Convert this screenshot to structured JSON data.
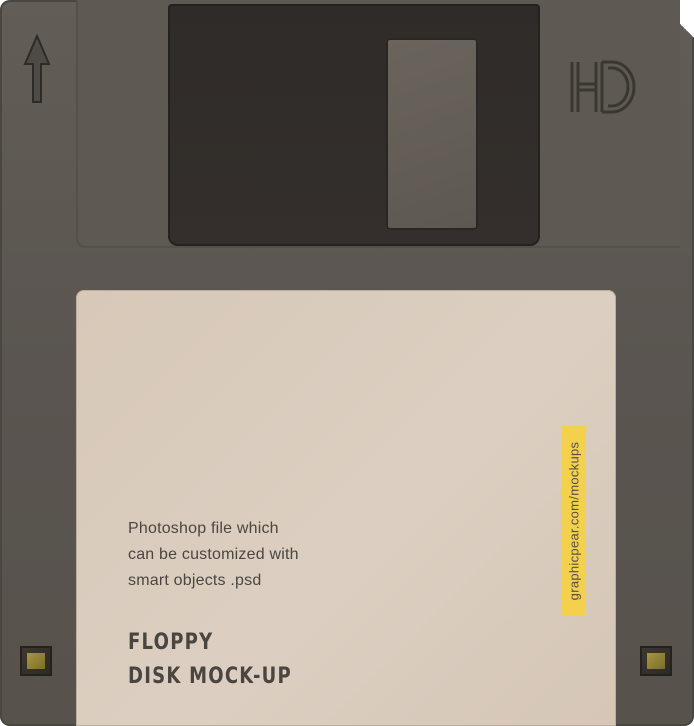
{
  "disk": {
    "description_lines": [
      "Photoshop file which",
      "can be customized with",
      "smart objects .psd"
    ],
    "title_lines": [
      "FLOPPY",
      "DISK MOCK-UP"
    ],
    "url": "graphicpear.com/mockups",
    "hd_logo": "HD"
  },
  "icons": {
    "insert_arrow": "arrow-up-icon",
    "hd": "hd-logo-icon"
  },
  "colors": {
    "body": "#5a5550",
    "shutter": "#312d2a",
    "label": "#d9cbbc",
    "url_highlight": "#f4d14c",
    "text": "#4b4641"
  }
}
